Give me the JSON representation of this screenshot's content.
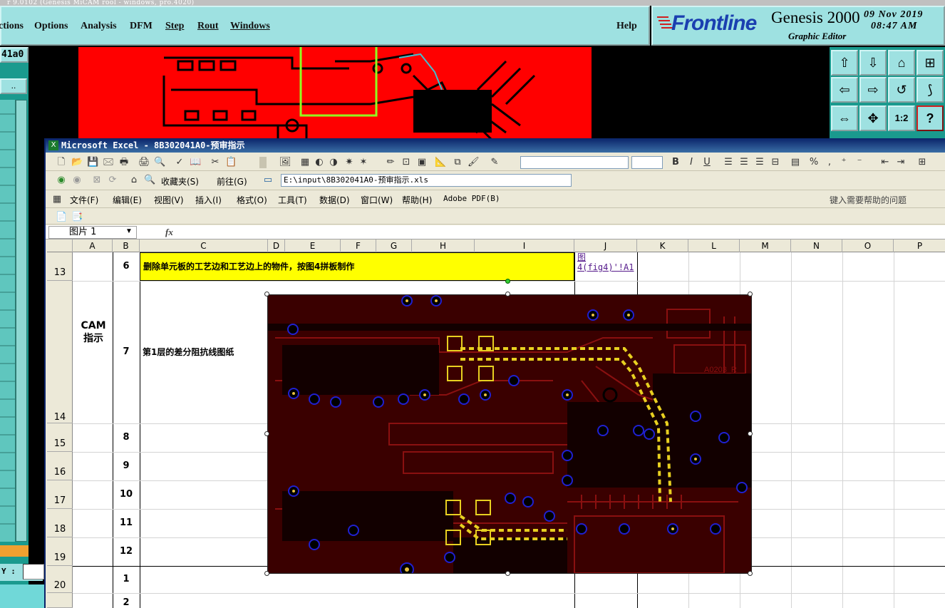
{
  "genesis": {
    "title_strip": "r 9.0102 (Genesis MiCAM rool - windows, pro.4020)",
    "menu": [
      {
        "label": "ctions",
        "underline": false
      },
      {
        "label": "Options",
        "underline": false
      },
      {
        "label": "Analysis",
        "underline": false
      },
      {
        "label": "DFM",
        "underline": false
      },
      {
        "label": "Step",
        "underline": true
      },
      {
        "label": "Rout",
        "underline": true
      },
      {
        "label": "Windows",
        "underline": true
      }
    ],
    "help": "Help",
    "logo": {
      "brand": "Frontline",
      "product": "Genesis 2000",
      "subtitle": "Graphic Editor",
      "date": "09 Nov 2019",
      "time": "08:47 AM"
    },
    "job_field": "41a0",
    "dots_button": "..",
    "y_label": "Y :",
    "panel_buttons": [
      "⇧",
      "⇩",
      "⌂",
      "⊞",
      "⇦",
      "⇨",
      "↺",
      "⟆",
      "⇔",
      "✥",
      "1:2",
      "?"
    ]
  },
  "excel": {
    "title": "Microsoft Excel - 8B302041A0-预审指示",
    "toolbar1": [
      "🗋",
      "📂",
      "💾",
      "🖂",
      "🖶",
      "🖨",
      "🔍",
      "✓",
      "📖",
      "✂",
      "📋",
      "📌",
      "🖼",
      "▦",
      "◐",
      "◑",
      "✷",
      "✶",
      "✏",
      "⊡",
      "▣",
      "📐",
      "⧉",
      "🖌",
      "✎",
      "⎘"
    ],
    "format": {
      "bold": "B",
      "italic": "I",
      "underline": "U",
      "percent": "%",
      "comma": ","
    },
    "toolbar2": {
      "favorites": "收藏夹(S)",
      "go": "前往(G)",
      "path": "E:\\input\\8B302041A0-预审指示.xls"
    },
    "menu": [
      "文件(F)",
      "编辑(E)",
      "视图(V)",
      "插入(I)",
      "格式(O)",
      "工具(T)",
      "数据(D)",
      "窗口(W)",
      "帮助(H)",
      "Adobe PDF(B)"
    ],
    "help_prompt": "键入需要帮助的问题",
    "name_box": "图片 1",
    "fx": "fx",
    "columns": [
      "A",
      "B",
      "C",
      "D",
      "E",
      "F",
      "G",
      "H",
      "I",
      "J",
      "K",
      "L",
      "M",
      "N",
      "O",
      "P"
    ],
    "rows": [
      {
        "num": "13",
        "b": "6"
      },
      {
        "num": "14",
        "b": "7"
      },
      {
        "num": "15",
        "b": "8"
      },
      {
        "num": "16",
        "b": "9"
      },
      {
        "num": "17",
        "b": "10"
      },
      {
        "num": "18",
        "b": "11"
      },
      {
        "num": "19",
        "b": "12"
      },
      {
        "num": "20",
        "b": "1"
      },
      {
        "num": "",
        "b": "2"
      }
    ],
    "cam_label": "CAM\n指示",
    "row13_text": "删除单元板的工艺边和工艺边上的物件，按图4拼板制作",
    "row13_link": "图4(fig4)'!A1",
    "row14_text": "第1层的差分阻抗线图纸"
  }
}
